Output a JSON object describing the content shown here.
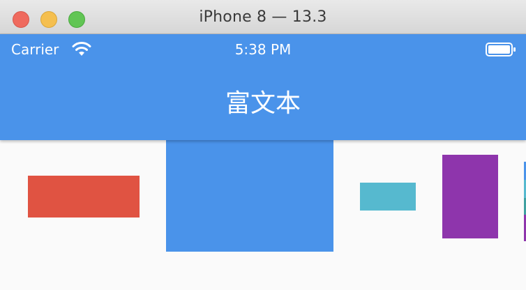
{
  "window": {
    "title": "iPhone 8 — 13.3"
  },
  "status_bar": {
    "carrier": "Carrier",
    "time": "5:38 PM"
  },
  "app_bar": {
    "title": "富文本"
  },
  "colors": {
    "app_bar": "#4a93ea",
    "block_red": "#e05342",
    "block_blue": "#4a93ea",
    "block_cyan": "#56b9cf",
    "block_purple": "#8e35ac"
  }
}
